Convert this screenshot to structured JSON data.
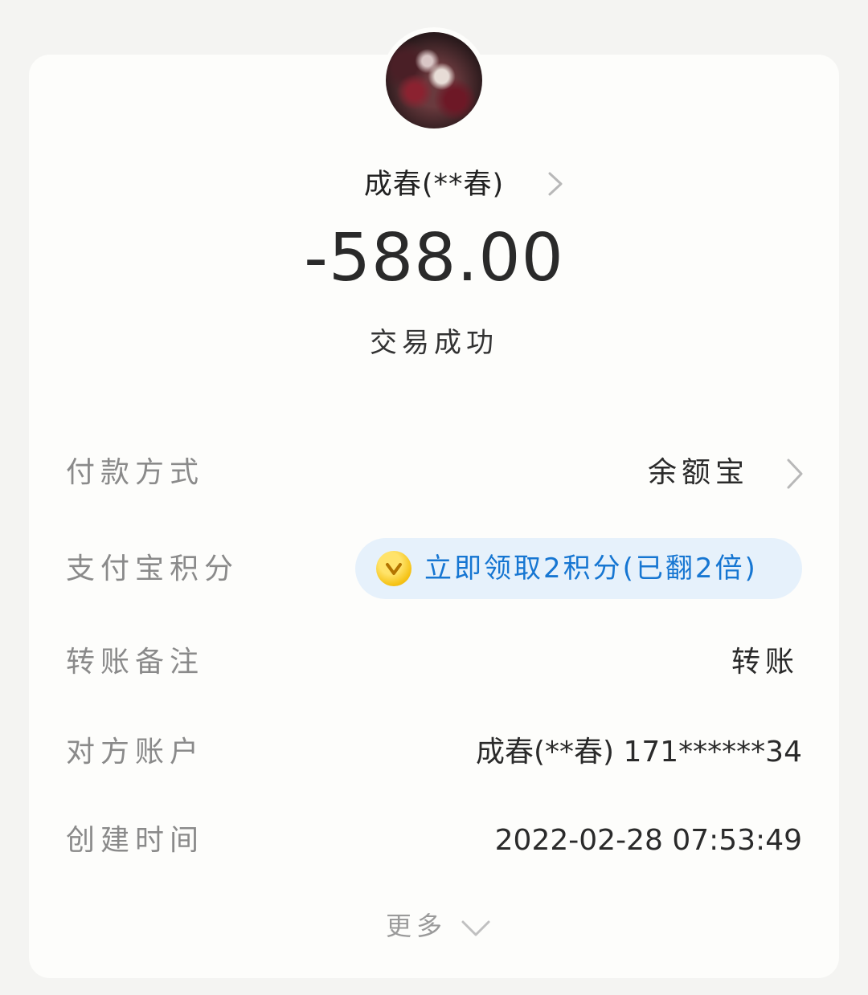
{
  "header": {
    "name": "成春(**春)",
    "amount": "-588.00",
    "status": "交易成功"
  },
  "details": {
    "payment_method_label": "付款方式",
    "payment_method_value": "余额宝",
    "points_label": "支付宝积分",
    "points_value": "立即领取2积分(已翻2倍)",
    "remark_label": "转账备注",
    "remark_value": "转账",
    "account_label": "对方账户",
    "account_value": "成春(**春) 171******34",
    "time_label": "创建时间",
    "time_value": "2022-02-28 07:53:49"
  },
  "footer": {
    "more_label": "更多"
  },
  "colors": {
    "background": "#f4f4f2",
    "card": "#fdfdfb",
    "label": "#8a8a8a",
    "value": "#2a2a2a",
    "points_text": "#1676d2",
    "points_pill": "#e6f1fb",
    "coin": "#f5c215"
  },
  "icons": {
    "avatar": "avatar",
    "name_chevron": "chevron-right-icon",
    "payment_chevron": "chevron-right-icon",
    "points_coin": "coin-icon",
    "more_chevron": "chevron-down-icon"
  }
}
